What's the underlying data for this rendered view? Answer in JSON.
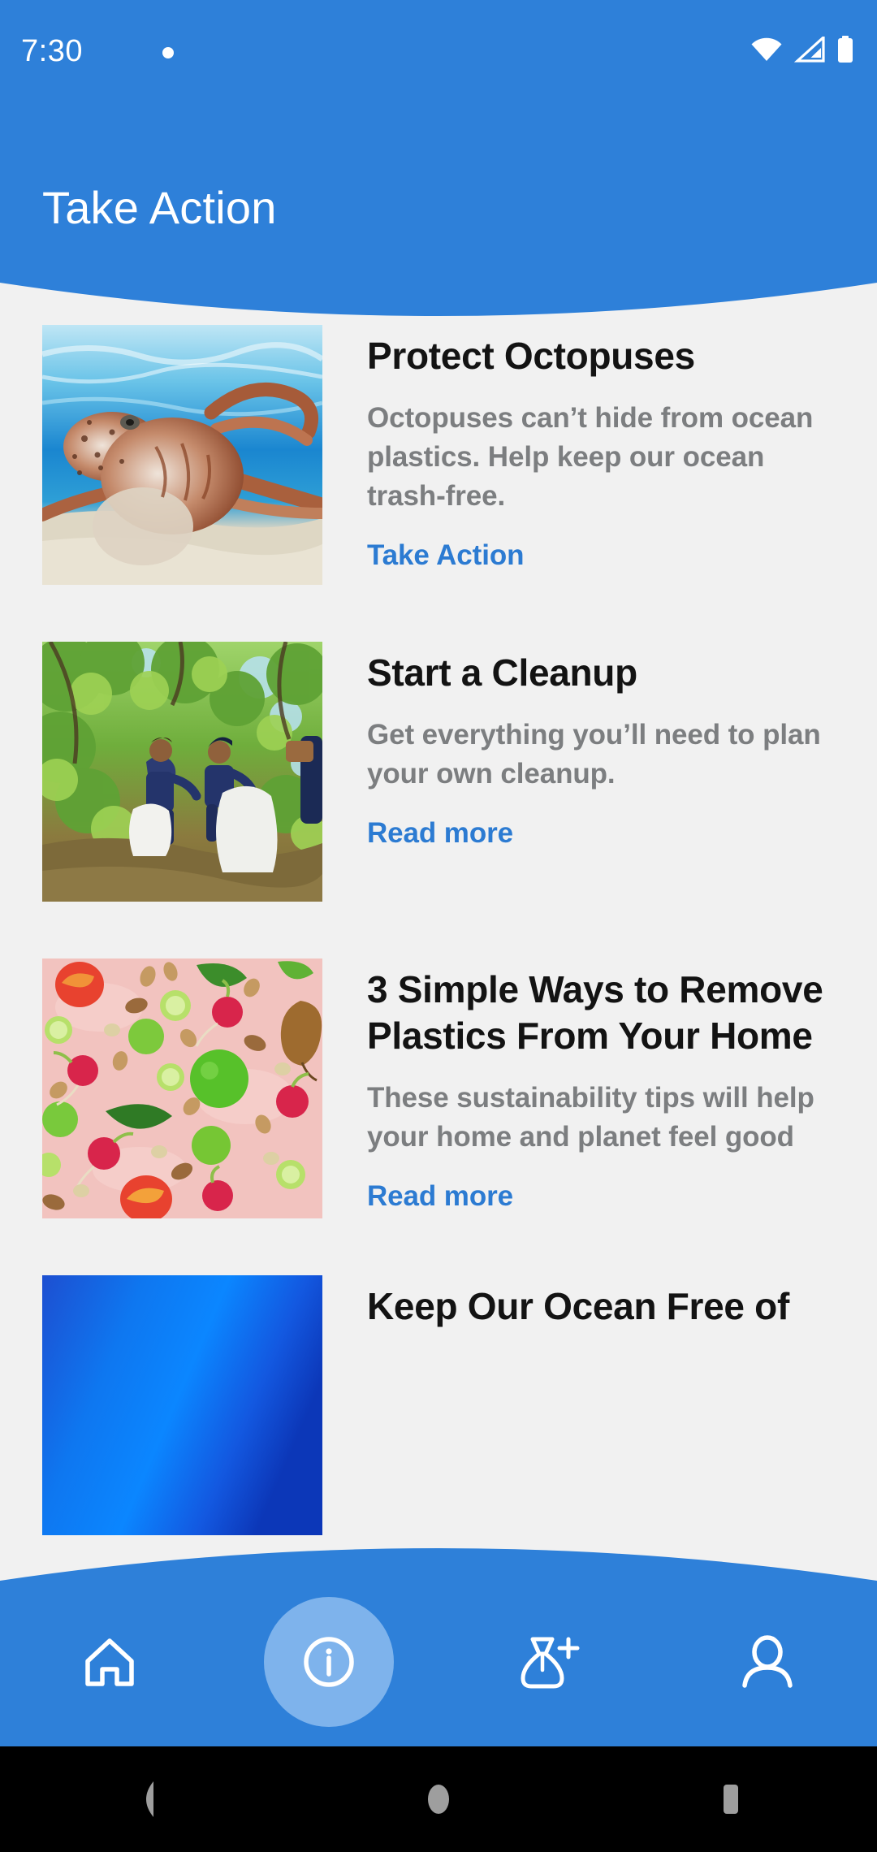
{
  "status_bar": {
    "time": "7:30",
    "notification_dot": "•",
    "wifi_icon": "wifi-icon",
    "signal_icon": "cell-signal-icon",
    "battery_icon": "battery-icon"
  },
  "header": {
    "title": "Take Action",
    "background_color": "#2e80d9",
    "text_color": "#ffffff"
  },
  "theme": {
    "page_background": "#f1f1f1",
    "accent_blue": "#2c7bd2",
    "title_color": "#131313",
    "body_color": "#7c7e80",
    "nav_active_pill": "#7eb3ec"
  },
  "cards": [
    {
      "title": "Protect Octopuses",
      "description": "Octopuses can’t hide from ocean plastics. Help keep our ocean trash-free.",
      "link_label": "Take Action",
      "image_name": "octopus-underwater-photo"
    },
    {
      "title": "Start a Cleanup",
      "description": "Get everything you’ll need to plan your own cleanup.",
      "link_label": "Read more",
      "image_name": "volunteers-collecting-trash-photo"
    },
    {
      "title": "3 Simple Ways to Remove Plastics From Your Home",
      "description": "These sustainability tips will help your home and planet feel good",
      "link_label": "Read more",
      "image_name": "fruits-vegetables-nuts-photo"
    },
    {
      "title": "Keep Our Ocean Free of",
      "description": "",
      "link_label": "",
      "image_name": "ocean-water-photo"
    }
  ],
  "bottom_nav": {
    "items": [
      {
        "name": "home",
        "icon": "home-icon",
        "active": false
      },
      {
        "name": "info",
        "icon": "info-circle-icon",
        "active": true
      },
      {
        "name": "log-trash",
        "icon": "trash-bag-plus-icon",
        "active": false
      },
      {
        "name": "profile",
        "icon": "person-icon",
        "active": false
      }
    ]
  },
  "system_nav": {
    "back": "back-triangle-icon",
    "home": "home-circle-icon",
    "recents": "recents-square-icon"
  }
}
